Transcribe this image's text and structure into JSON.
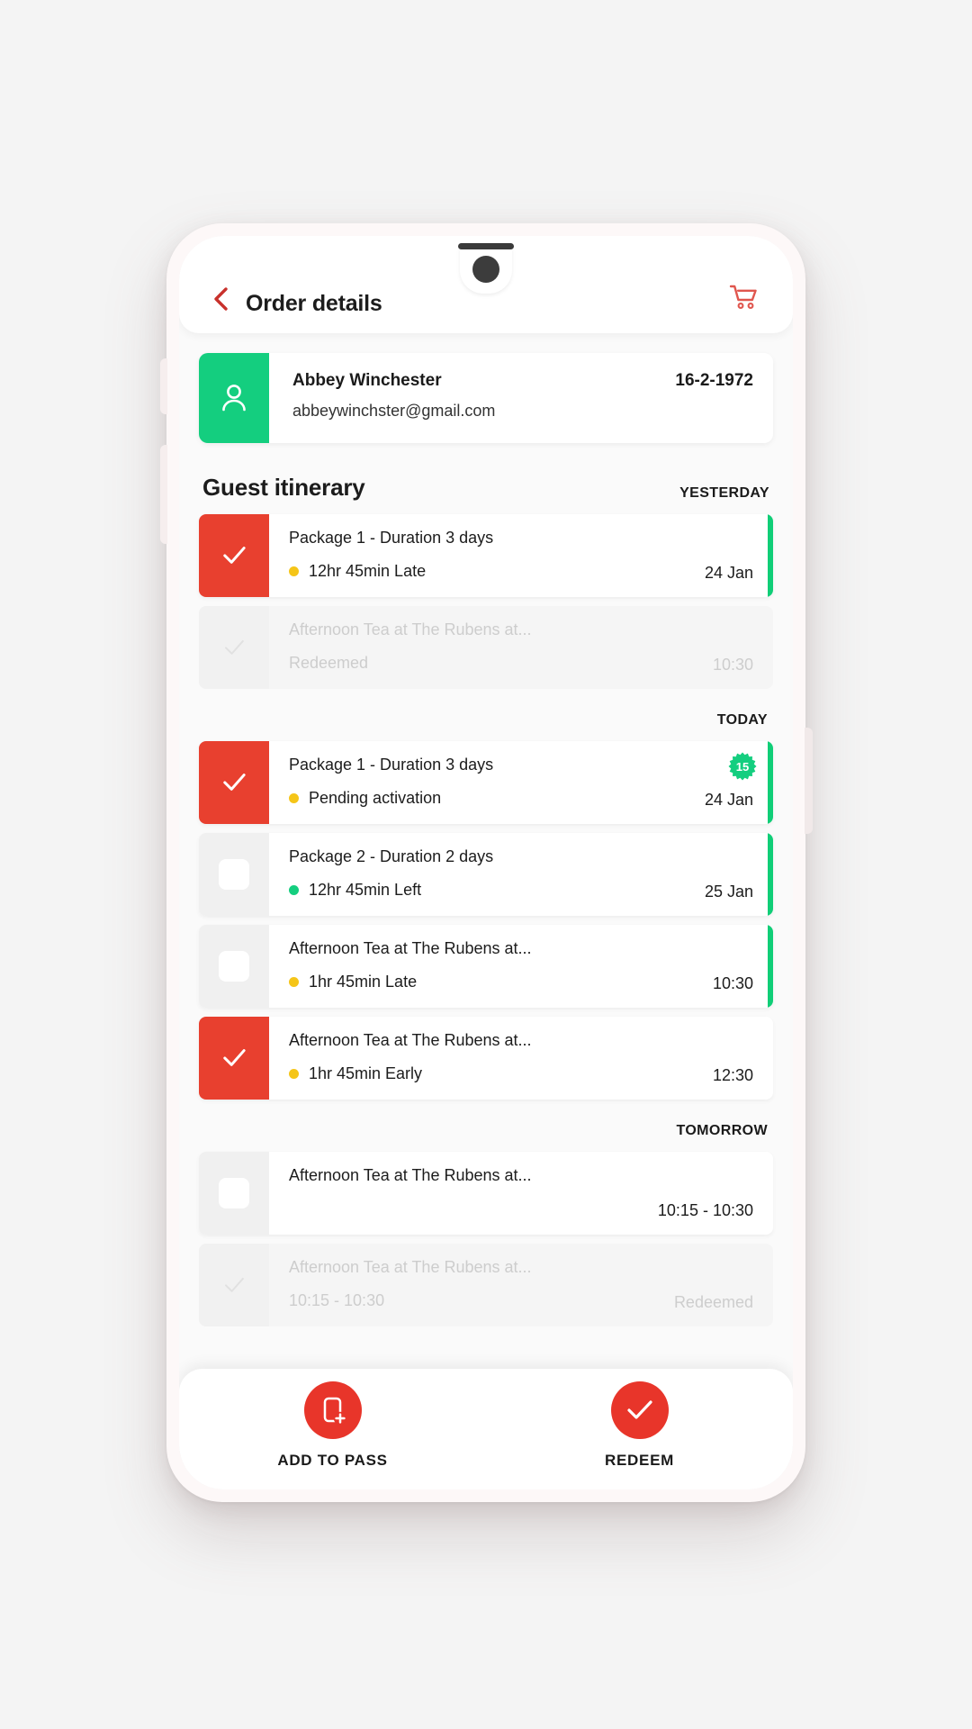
{
  "header": {
    "back_icon": "chevron-left-icon",
    "title": "Order details",
    "cart_icon": "shopping-cart-icon"
  },
  "guest": {
    "avatar_icon": "person-icon",
    "name": "Abbey Winchester",
    "email": "abbeywinchster@gmail.com",
    "dob": "16-2-1972"
  },
  "itinerary": {
    "section_title": "Guest itinerary",
    "groups": [
      {
        "day_label": "YESTERDAY",
        "items": [
          {
            "title": "Package 1 - Duration 3 days",
            "status": "12hr 45min   Late",
            "status_color": "#f5c518",
            "right": "24 Jan",
            "checked": true,
            "dimmed": false,
            "has_bar": true,
            "badge": null
          },
          {
            "title": "Afternoon Tea at The Rubens at...",
            "status": "Redeemed",
            "status_color": null,
            "right": "10:30",
            "checked": true,
            "dimmed": true,
            "has_bar": false,
            "badge": null
          }
        ]
      },
      {
        "day_label": "TODAY",
        "items": [
          {
            "title": "Package 1 - Duration 3 days",
            "status": "Pending activation",
            "status_color": "#f5c518",
            "right": "24 Jan",
            "checked": true,
            "dimmed": false,
            "has_bar": true,
            "badge": "15"
          },
          {
            "title": "Package 2 - Duration 2 days",
            "status": "12hr 45min Left",
            "status_color": "#14ce7f",
            "right": "25 Jan",
            "checked": false,
            "dimmed": false,
            "has_bar": true,
            "badge": null
          },
          {
            "title": "Afternoon Tea at The Rubens at...",
            "status": "1hr 45min Late",
            "status_color": "#f5c518",
            "right": "10:30",
            "checked": false,
            "dimmed": false,
            "has_bar": true,
            "badge": null
          },
          {
            "title": "Afternoon Tea at The Rubens at...",
            "status": "1hr 45min Early",
            "status_color": "#f5c518",
            "right": "12:30",
            "checked": true,
            "dimmed": false,
            "has_bar": false,
            "badge": null
          }
        ]
      },
      {
        "day_label": "TOMORROW",
        "items": [
          {
            "title": "Afternoon Tea at The Rubens at...",
            "status": "",
            "status_color": null,
            "right": "10:15 - 10:30",
            "checked": false,
            "dimmed": false,
            "has_bar": false,
            "badge": null
          },
          {
            "title": "Afternoon Tea at The Rubens at...",
            "status": "10:15 - 10:30",
            "status_color": null,
            "right": "Redeemed",
            "checked": true,
            "dimmed": true,
            "has_bar": false,
            "badge": null
          }
        ]
      }
    ]
  },
  "bottom_actions": [
    {
      "label": "ADD TO PASS",
      "icon": "add-to-wallet-icon"
    },
    {
      "label": "REDEEM",
      "icon": "check-icon"
    }
  ],
  "colors": {
    "brand_red": "#e8402f",
    "accent_green": "#14ce7f",
    "bar_green": "#10ce77",
    "amber": "#f5c518"
  }
}
